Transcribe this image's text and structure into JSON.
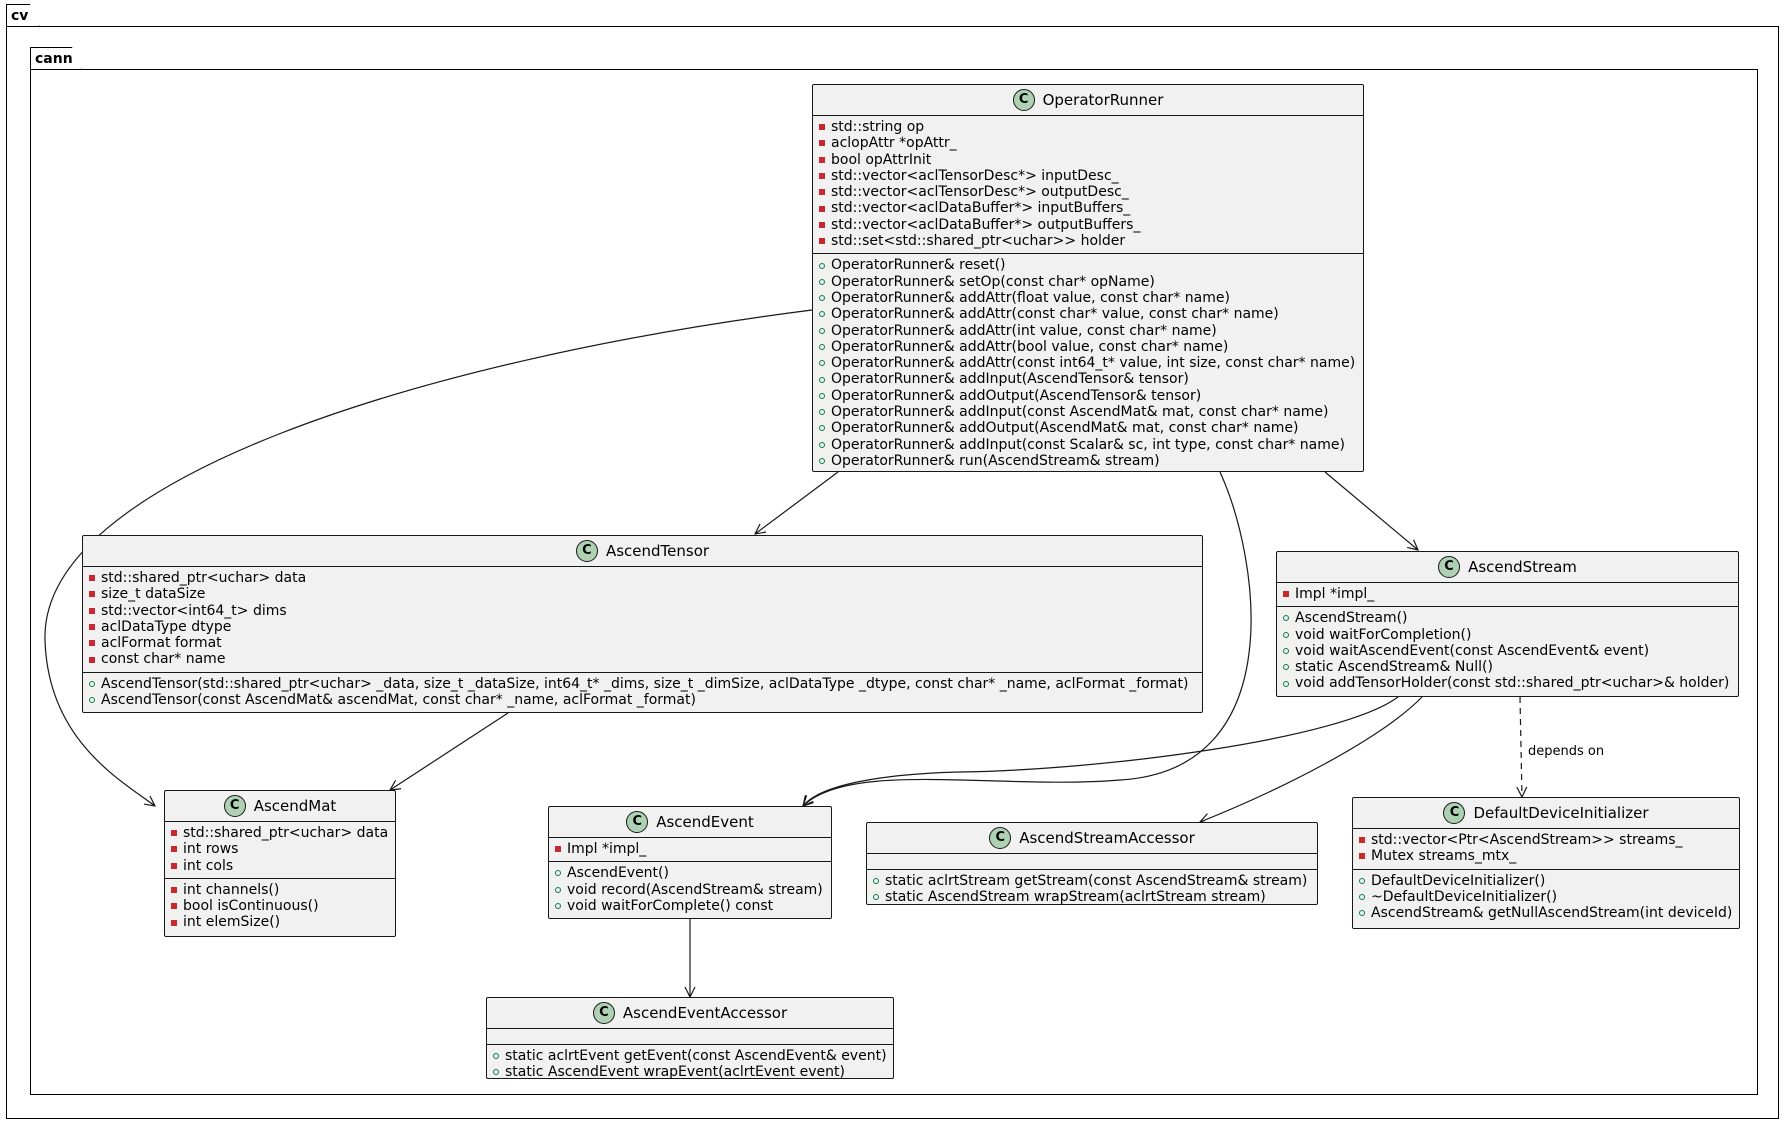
{
  "packages": {
    "outer": "cv",
    "inner": "cann"
  },
  "class_badge": "C",
  "classes": {
    "operator_runner": {
      "name": "OperatorRunner",
      "attrs": [
        {
          "v": "-",
          "t": "std::string op"
        },
        {
          "v": "-",
          "t": "aclopAttr *opAttr_"
        },
        {
          "v": "-",
          "t": "bool opAttrInit"
        },
        {
          "v": "-",
          "t": "std::vector<aclTensorDesc*> inputDesc_"
        },
        {
          "v": "-",
          "t": "std::vector<aclTensorDesc*> outputDesc_"
        },
        {
          "v": "-",
          "t": "std::vector<aclDataBuffer*> inputBuffers_"
        },
        {
          "v": "-",
          "t": "std::vector<aclDataBuffer*> outputBuffers_"
        },
        {
          "v": "-",
          "t": "std::set<std::shared_ptr<uchar>> holder"
        }
      ],
      "methods": [
        {
          "v": "+",
          "t": "OperatorRunner& reset()"
        },
        {
          "v": "+",
          "t": "OperatorRunner& setOp(const char* opName)"
        },
        {
          "v": "+",
          "t": "OperatorRunner& addAttr(float value, const char* name)"
        },
        {
          "v": "+",
          "t": "OperatorRunner& addAttr(const char* value, const char* name)"
        },
        {
          "v": "+",
          "t": "OperatorRunner& addAttr(int value, const char* name)"
        },
        {
          "v": "+",
          "t": "OperatorRunner& addAttr(bool value, const char* name)"
        },
        {
          "v": "+",
          "t": "OperatorRunner& addAttr(const int64_t* value, int size, const char* name)"
        },
        {
          "v": "+",
          "t": "OperatorRunner& addInput(AscendTensor& tensor)"
        },
        {
          "v": "+",
          "t": "OperatorRunner& addOutput(AscendTensor& tensor)"
        },
        {
          "v": "+",
          "t": "OperatorRunner& addInput(const AscendMat& mat, const char* name)"
        },
        {
          "v": "+",
          "t": "OperatorRunner& addOutput(AscendMat& mat, const char* name)"
        },
        {
          "v": "+",
          "t": "OperatorRunner& addInput(const Scalar& sc, int type, const char* name)"
        },
        {
          "v": "+",
          "t": "OperatorRunner& run(AscendStream& stream)"
        }
      ]
    },
    "ascend_tensor": {
      "name": "AscendTensor",
      "attrs": [
        {
          "v": "-",
          "t": "std::shared_ptr<uchar> data"
        },
        {
          "v": "-",
          "t": "size_t dataSize"
        },
        {
          "v": "-",
          "t": "std::vector<int64_t> dims"
        },
        {
          "v": "-",
          "t": "aclDataType dtype"
        },
        {
          "v": "-",
          "t": "aclFormat format"
        },
        {
          "v": "-",
          "t": "const char* name"
        }
      ],
      "methods": [
        {
          "v": "+",
          "t": "AscendTensor(std::shared_ptr<uchar> _data, size_t _dataSize, int64_t* _dims, size_t _dimSize, aclDataType _dtype, const char* _name, aclFormat _format)"
        },
        {
          "v": "+",
          "t": "AscendTensor(const AscendMat& ascendMat, const char* _name, aclFormat _format)"
        }
      ]
    },
    "ascend_stream": {
      "name": "AscendStream",
      "attrs": [
        {
          "v": "-",
          "t": "Impl *impl_"
        }
      ],
      "methods": [
        {
          "v": "+",
          "t": "AscendStream()"
        },
        {
          "v": "+",
          "t": "void waitForCompletion()"
        },
        {
          "v": "+",
          "t": "void waitAscendEvent(const AscendEvent& event)"
        },
        {
          "v": "+",
          "t": "static AscendStream& Null()"
        },
        {
          "v": "+",
          "t": "void addTensorHolder(const std::shared_ptr<uchar>& holder)"
        }
      ]
    },
    "ascend_mat": {
      "name": "AscendMat",
      "attrs": [
        {
          "v": "-",
          "t": "std::shared_ptr<uchar> data"
        },
        {
          "v": "-",
          "t": "int rows"
        },
        {
          "v": "-",
          "t": "int cols"
        }
      ],
      "methods": [
        {
          "v": "-",
          "t": "int channels()"
        },
        {
          "v": "-",
          "t": "bool isContinuous()"
        },
        {
          "v": "-",
          "t": "int elemSize()"
        }
      ]
    },
    "ascend_event": {
      "name": "AscendEvent",
      "attrs": [
        {
          "v": "-",
          "t": "Impl *impl_"
        }
      ],
      "methods": [
        {
          "v": "+",
          "t": "AscendEvent()"
        },
        {
          "v": "+",
          "t": "void record(AscendStream& stream)"
        },
        {
          "v": "+",
          "t": "void waitForComplete() const"
        }
      ]
    },
    "ascend_stream_accessor": {
      "name": "AscendStreamAccessor",
      "attrs": [],
      "methods": [
        {
          "v": "+",
          "t": "static aclrtStream getStream(const AscendStream& stream)"
        },
        {
          "v": "+",
          "t": "static AscendStream wrapStream(aclrtStream stream)"
        }
      ]
    },
    "default_device_initializer": {
      "name": "DefaultDeviceInitializer",
      "attrs": [
        {
          "v": "-",
          "t": "std::vector<Ptr<AscendStream>> streams_"
        },
        {
          "v": "-",
          "t": "Mutex streams_mtx_"
        }
      ],
      "methods": [
        {
          "v": "+",
          "t": "DefaultDeviceInitializer()"
        },
        {
          "v": "+",
          "t": "~DefaultDeviceInitializer()"
        },
        {
          "v": "+",
          "t": "AscendStream& getNullAscendStream(int deviceId)"
        }
      ]
    },
    "ascend_event_accessor": {
      "name": "AscendEventAccessor",
      "attrs": [],
      "methods": [
        {
          "v": "+",
          "t": "static aclrtEvent getEvent(const AscendEvent& event)"
        },
        {
          "v": "+",
          "t": "static AscendEvent wrapEvent(aclrtEvent event)"
        }
      ]
    }
  },
  "relations": [
    {
      "from": "OperatorRunner",
      "to": "AscendMat",
      "style": "solid"
    },
    {
      "from": "OperatorRunner",
      "to": "AscendTensor",
      "style": "solid"
    },
    {
      "from": "OperatorRunner",
      "to": "AscendEvent",
      "style": "solid"
    },
    {
      "from": "OperatorRunner",
      "to": "AscendStream",
      "style": "solid"
    },
    {
      "from": "AscendTensor",
      "to": "AscendMat",
      "style": "solid"
    },
    {
      "from": "AscendStream",
      "to": "AscendEvent",
      "style": "solid"
    },
    {
      "from": "AscendStream",
      "to": "AscendStreamAccessor",
      "style": "solid"
    },
    {
      "from": "AscendStream",
      "to": "DefaultDeviceInitializer",
      "style": "dashed",
      "label": "depends on"
    },
    {
      "from": "AscendEvent",
      "to": "AscendEventAccessor",
      "style": "solid"
    }
  ]
}
